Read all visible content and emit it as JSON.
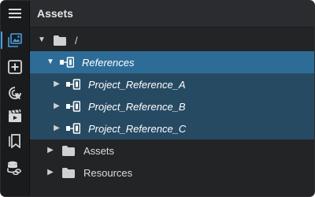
{
  "rail": {
    "items": [
      {
        "icon": "hamburger-menu-icon"
      },
      {
        "icon": "image-gallery-icon",
        "active": true
      },
      {
        "icon": "add-box-icon"
      },
      {
        "icon": "touch-target-icon"
      },
      {
        "icon": "clapperboard-icon"
      },
      {
        "icon": "bookmark-pages-icon"
      },
      {
        "icon": "database-link-icon"
      }
    ]
  },
  "panel": {
    "title": "Assets"
  },
  "tree": {
    "rows": [
      {
        "label": "/",
        "icon": "folder-icon",
        "expanded": true
      },
      {
        "label": "References",
        "icon": "reference-icon",
        "expanded": true,
        "selected": true
      },
      {
        "label": "Project_Reference_A",
        "icon": "reference-icon",
        "expanded": false
      },
      {
        "label": "Project_Reference_B",
        "icon": "reference-icon",
        "expanded": false
      },
      {
        "label": "Project_Reference_C",
        "icon": "reference-icon",
        "expanded": false
      },
      {
        "label": "Assets",
        "icon": "folder-icon",
        "expanded": false
      },
      {
        "label": "Resources",
        "icon": "folder-icon",
        "expanded": false
      }
    ]
  },
  "colors": {
    "selected_row": "#2e6c98",
    "child_row": "#274a63",
    "accent": "#4aa0e0",
    "panel_bg": "#222426",
    "rail_bg": "#1a1b1d"
  }
}
